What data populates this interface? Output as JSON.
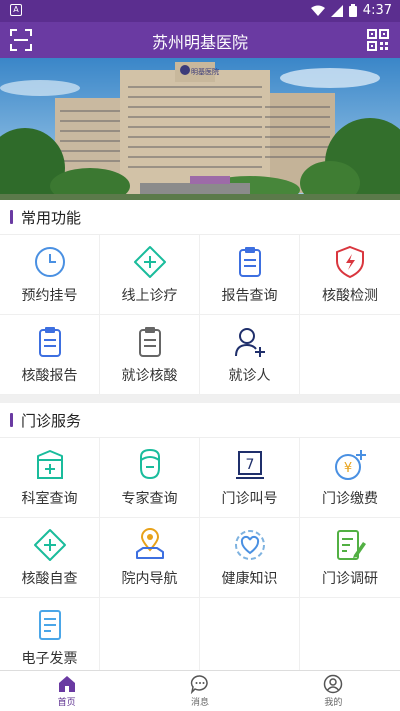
{
  "status_bar": {
    "time": "4:37"
  },
  "app_bar": {
    "title": "苏州明基医院"
  },
  "banner": {
    "hospital_sign": "明基医院"
  },
  "sections": [
    {
      "title": "常用功能",
      "items": [
        {
          "label": "预约挂号",
          "icon": "clock-icon"
        },
        {
          "label": "线上诊疗",
          "icon": "online-consult-icon"
        },
        {
          "label": "报告查询",
          "icon": "report-clipboard-icon"
        },
        {
          "label": "核酸检测",
          "icon": "nucleic-shield-icon"
        },
        {
          "label": "核酸报告",
          "icon": "nucleic-report-icon"
        },
        {
          "label": "就诊核酸",
          "icon": "visit-nucleic-icon"
        },
        {
          "label": "就诊人",
          "icon": "add-patient-icon"
        }
      ]
    },
    {
      "title": "门诊服务",
      "items": [
        {
          "label": "科室查询",
          "icon": "department-icon"
        },
        {
          "label": "专家查询",
          "icon": "doctor-icon"
        },
        {
          "label": "门诊叫号",
          "icon": "queue-number-icon"
        },
        {
          "label": "门诊缴费",
          "icon": "payment-icon"
        },
        {
          "label": "核酸自查",
          "icon": "self-check-icon"
        },
        {
          "label": "院内导航",
          "icon": "navigation-pin-icon"
        },
        {
          "label": "健康知识",
          "icon": "health-knowledge-icon"
        },
        {
          "label": "门诊调研",
          "icon": "survey-icon"
        },
        {
          "label": "电子发票",
          "icon": "invoice-icon"
        }
      ]
    }
  ],
  "tabs": [
    {
      "label": "首页",
      "icon": "home-icon",
      "active": true
    },
    {
      "label": "消息",
      "icon": "message-icon",
      "active": false
    },
    {
      "label": "我的",
      "icon": "profile-icon",
      "active": false
    }
  ],
  "colors": {
    "brand": "#6a3aa2",
    "status_bar": "#5b2e8f"
  }
}
